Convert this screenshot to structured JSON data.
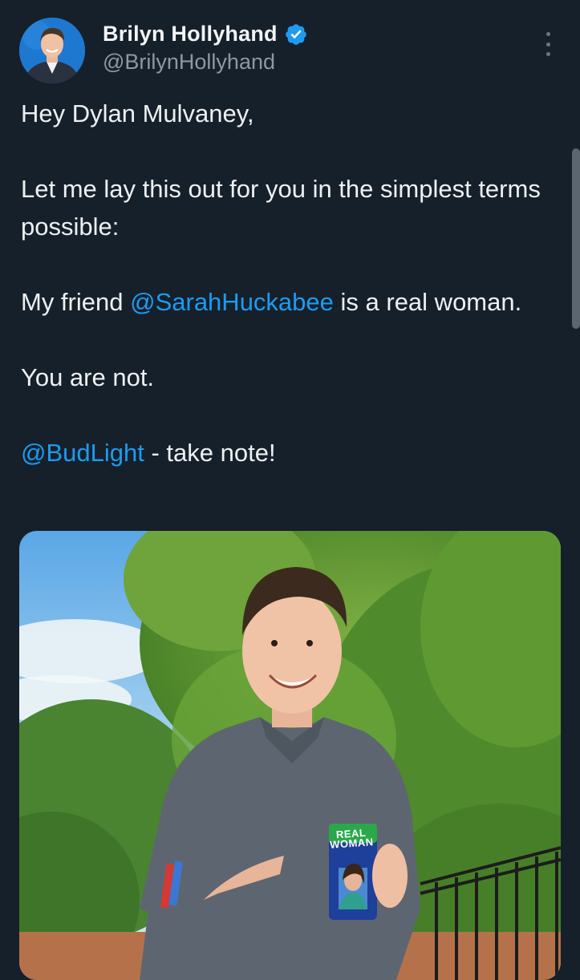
{
  "author": {
    "display_name": "Brilyn Hollyhand",
    "handle": "@BrilynHollyhand",
    "verified_icon": "verified-badge-icon",
    "avatar_icon": "profile-avatar"
  },
  "tweet": {
    "line1": "Hey Dylan Mulvaney,",
    "line2": "Let me lay this out for you in the simplest terms possible:",
    "line3_prefix": "My friend ",
    "line3_mention": "@SarahHuckabee",
    "line3_suffix": " is a real woman.",
    "line4": "You are not.",
    "line5_mention": "@BudLight",
    "line5_suffix": " - take note!"
  },
  "media": {
    "koozie_line1": "REAL",
    "koozie_line2": "WOMAN"
  },
  "colors": {
    "background": "#16202b",
    "text": "#e7e9ea",
    "secondary": "#8b98a5",
    "link": "#1d9bf0",
    "verified": "#1d9bf0"
  },
  "icons": {
    "more": "more-options-icon"
  }
}
